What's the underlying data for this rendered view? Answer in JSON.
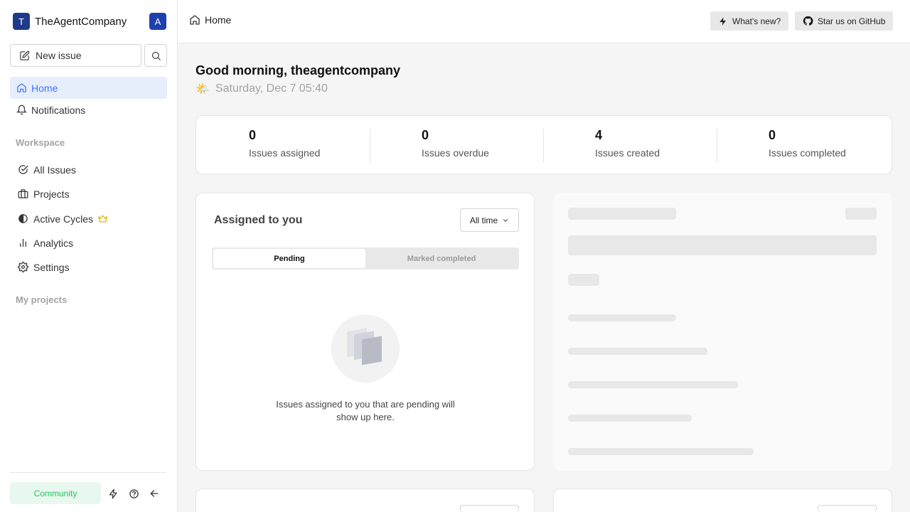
{
  "workspace": {
    "logo_letter": "T",
    "name": "TheAgentCompany",
    "avatar_letter": "A"
  },
  "sidebar": {
    "new_issue_label": "New issue",
    "nav": [
      {
        "label": "Home",
        "icon": "home-icon",
        "active": true
      },
      {
        "label": "Notifications",
        "icon": "bell-icon",
        "active": false
      }
    ],
    "workspace_section_label": "Workspace",
    "workspace_items": [
      {
        "label": "All Issues",
        "icon": "check-circle-icon"
      },
      {
        "label": "Projects",
        "icon": "briefcase-icon"
      },
      {
        "label": "Active Cycles",
        "icon": "contrast-icon",
        "badge_icon": "crown-icon"
      },
      {
        "label": "Analytics",
        "icon": "bar-chart-icon"
      },
      {
        "label": "Settings",
        "icon": "gear-icon"
      }
    ],
    "my_projects_label": "My projects",
    "footer": {
      "community_label": "Community"
    }
  },
  "topbar": {
    "breadcrumb": "Home",
    "whats_new_label": "What's new?",
    "github_label": "Star us on GitHub"
  },
  "main": {
    "greeting": "Good morning, theagentcompany",
    "date_emoji": "🌤️",
    "date_text": "Saturday, Dec 7 05:40",
    "stats": [
      {
        "value": "0",
        "label": "Issues assigned"
      },
      {
        "value": "0",
        "label": "Issues overdue"
      },
      {
        "value": "4",
        "label": "Issues created"
      },
      {
        "value": "0",
        "label": "Issues completed"
      }
    ],
    "assigned_card": {
      "title": "Assigned to you",
      "filter": "All time",
      "tabs": [
        "Pending",
        "Marked completed"
      ],
      "empty_text": "Issues assigned to you that are pending will show up here."
    }
  },
  "colors": {
    "accent": "#3f76ff",
    "logo_bg": "#1e3a8a",
    "community_bg": "#e8f8ee",
    "community_text": "#22c55e",
    "crown": "#eab308"
  }
}
